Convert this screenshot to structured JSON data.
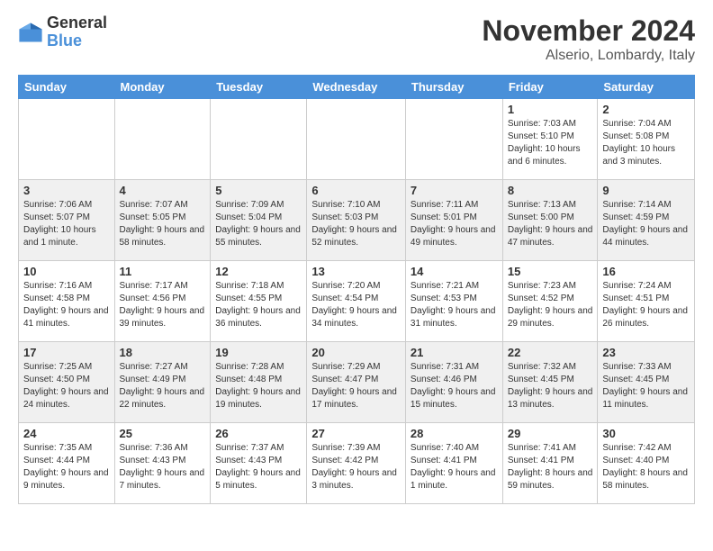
{
  "logo": {
    "general": "General",
    "blue": "Blue"
  },
  "header": {
    "month": "November 2024",
    "location": "Alserio, Lombardy, Italy"
  },
  "weekdays": [
    "Sunday",
    "Monday",
    "Tuesday",
    "Wednesday",
    "Thursday",
    "Friday",
    "Saturday"
  ],
  "weeks": [
    [
      {
        "day": "",
        "info": ""
      },
      {
        "day": "",
        "info": ""
      },
      {
        "day": "",
        "info": ""
      },
      {
        "day": "",
        "info": ""
      },
      {
        "day": "",
        "info": ""
      },
      {
        "day": "1",
        "info": "Sunrise: 7:03 AM\nSunset: 5:10 PM\nDaylight: 10 hours and 6 minutes."
      },
      {
        "day": "2",
        "info": "Sunrise: 7:04 AM\nSunset: 5:08 PM\nDaylight: 10 hours and 3 minutes."
      }
    ],
    [
      {
        "day": "3",
        "info": "Sunrise: 7:06 AM\nSunset: 5:07 PM\nDaylight: 10 hours and 1 minute."
      },
      {
        "day": "4",
        "info": "Sunrise: 7:07 AM\nSunset: 5:05 PM\nDaylight: 9 hours and 58 minutes."
      },
      {
        "day": "5",
        "info": "Sunrise: 7:09 AM\nSunset: 5:04 PM\nDaylight: 9 hours and 55 minutes."
      },
      {
        "day": "6",
        "info": "Sunrise: 7:10 AM\nSunset: 5:03 PM\nDaylight: 9 hours and 52 minutes."
      },
      {
        "day": "7",
        "info": "Sunrise: 7:11 AM\nSunset: 5:01 PM\nDaylight: 9 hours and 49 minutes."
      },
      {
        "day": "8",
        "info": "Sunrise: 7:13 AM\nSunset: 5:00 PM\nDaylight: 9 hours and 47 minutes."
      },
      {
        "day": "9",
        "info": "Sunrise: 7:14 AM\nSunset: 4:59 PM\nDaylight: 9 hours and 44 minutes."
      }
    ],
    [
      {
        "day": "10",
        "info": "Sunrise: 7:16 AM\nSunset: 4:58 PM\nDaylight: 9 hours and 41 minutes."
      },
      {
        "day": "11",
        "info": "Sunrise: 7:17 AM\nSunset: 4:56 PM\nDaylight: 9 hours and 39 minutes."
      },
      {
        "day": "12",
        "info": "Sunrise: 7:18 AM\nSunset: 4:55 PM\nDaylight: 9 hours and 36 minutes."
      },
      {
        "day": "13",
        "info": "Sunrise: 7:20 AM\nSunset: 4:54 PM\nDaylight: 9 hours and 34 minutes."
      },
      {
        "day": "14",
        "info": "Sunrise: 7:21 AM\nSunset: 4:53 PM\nDaylight: 9 hours and 31 minutes."
      },
      {
        "day": "15",
        "info": "Sunrise: 7:23 AM\nSunset: 4:52 PM\nDaylight: 9 hours and 29 minutes."
      },
      {
        "day": "16",
        "info": "Sunrise: 7:24 AM\nSunset: 4:51 PM\nDaylight: 9 hours and 26 minutes."
      }
    ],
    [
      {
        "day": "17",
        "info": "Sunrise: 7:25 AM\nSunset: 4:50 PM\nDaylight: 9 hours and 24 minutes."
      },
      {
        "day": "18",
        "info": "Sunrise: 7:27 AM\nSunset: 4:49 PM\nDaylight: 9 hours and 22 minutes."
      },
      {
        "day": "19",
        "info": "Sunrise: 7:28 AM\nSunset: 4:48 PM\nDaylight: 9 hours and 19 minutes."
      },
      {
        "day": "20",
        "info": "Sunrise: 7:29 AM\nSunset: 4:47 PM\nDaylight: 9 hours and 17 minutes."
      },
      {
        "day": "21",
        "info": "Sunrise: 7:31 AM\nSunset: 4:46 PM\nDaylight: 9 hours and 15 minutes."
      },
      {
        "day": "22",
        "info": "Sunrise: 7:32 AM\nSunset: 4:45 PM\nDaylight: 9 hours and 13 minutes."
      },
      {
        "day": "23",
        "info": "Sunrise: 7:33 AM\nSunset: 4:45 PM\nDaylight: 9 hours and 11 minutes."
      }
    ],
    [
      {
        "day": "24",
        "info": "Sunrise: 7:35 AM\nSunset: 4:44 PM\nDaylight: 9 hours and 9 minutes."
      },
      {
        "day": "25",
        "info": "Sunrise: 7:36 AM\nSunset: 4:43 PM\nDaylight: 9 hours and 7 minutes."
      },
      {
        "day": "26",
        "info": "Sunrise: 7:37 AM\nSunset: 4:43 PM\nDaylight: 9 hours and 5 minutes."
      },
      {
        "day": "27",
        "info": "Sunrise: 7:39 AM\nSunset: 4:42 PM\nDaylight: 9 hours and 3 minutes."
      },
      {
        "day": "28",
        "info": "Sunrise: 7:40 AM\nSunset: 4:41 PM\nDaylight: 9 hours and 1 minute."
      },
      {
        "day": "29",
        "info": "Sunrise: 7:41 AM\nSunset: 4:41 PM\nDaylight: 8 hours and 59 minutes."
      },
      {
        "day": "30",
        "info": "Sunrise: 7:42 AM\nSunset: 4:40 PM\nDaylight: 8 hours and 58 minutes."
      }
    ]
  ]
}
